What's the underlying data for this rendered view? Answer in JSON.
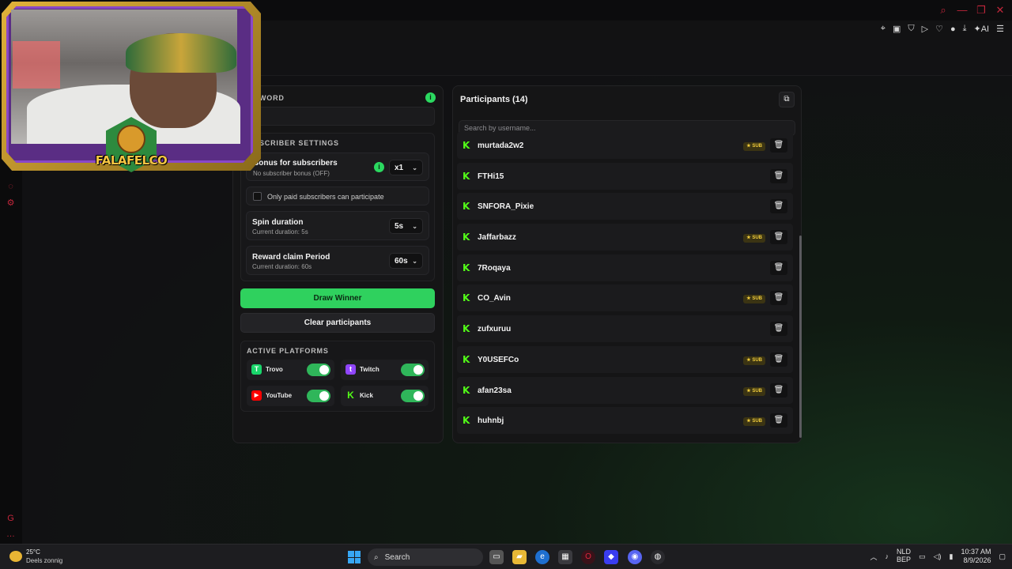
{
  "left_panel": {
    "keyword_label": "WORD",
    "subscriber_settings_label": "SCRIBER SETTINGS",
    "bonus": {
      "title": "Bonus for subscribers",
      "subtitle": "No subscriber bonus (OFF)",
      "value": "x1"
    },
    "paid_only_label": "Only paid subscribers can participate",
    "spin": {
      "title": "Spin duration",
      "subtitle": "Current duration: 5s",
      "value": "5s"
    },
    "reward": {
      "title": "Reward claim Period",
      "subtitle": "Current duration: 60s",
      "value": "60s"
    },
    "draw_button": "Draw Winner",
    "clear_button": "Clear participants",
    "platforms_label": "ACTIVE PLATFORMS",
    "platforms": [
      {
        "name": "Trovo",
        "enabled": true,
        "color": "#19d66b"
      },
      {
        "name": "Twitch",
        "enabled": true,
        "color": "#9146ff"
      },
      {
        "name": "YouTube",
        "enabled": true,
        "color": "#ff0000"
      },
      {
        "name": "Kick",
        "enabled": true,
        "color": "#53fc18"
      }
    ]
  },
  "participants": {
    "title": "Participants (14)",
    "search_placeholder": "Search by username...",
    "sub_badge_label": "SUB",
    "rows": [
      {
        "username": "murtada2w2",
        "sub": true
      },
      {
        "username": "FTHi15",
        "sub": false
      },
      {
        "username": "SNFORA_Pixie",
        "sub": false
      },
      {
        "username": "Jaffarbazz",
        "sub": true
      },
      {
        "username": "7Roqaya",
        "sub": false
      },
      {
        "username": "CO_Avin",
        "sub": true
      },
      {
        "username": "zufxuruu",
        "sub": false
      },
      {
        "username": "Y0USEFCo",
        "sub": true
      },
      {
        "username": "afan23sa",
        "sub": true
      },
      {
        "username": "huhnbj",
        "sub": true
      }
    ]
  },
  "overlay": {
    "logo_text": "FALAFELCO"
  },
  "taskbar": {
    "temperature": "25°C",
    "weather": "Deels zonnig",
    "search_label": "Search",
    "lang_top": "NLD",
    "lang_bottom": "BEP",
    "time": "10:37 AM",
    "date": "8/9/2026"
  },
  "colors": {
    "accent_green": "#2fd15e",
    "kick_green": "#53fc18",
    "sub_gold": "#f1cc3c",
    "browser_red": "#c2263b"
  }
}
